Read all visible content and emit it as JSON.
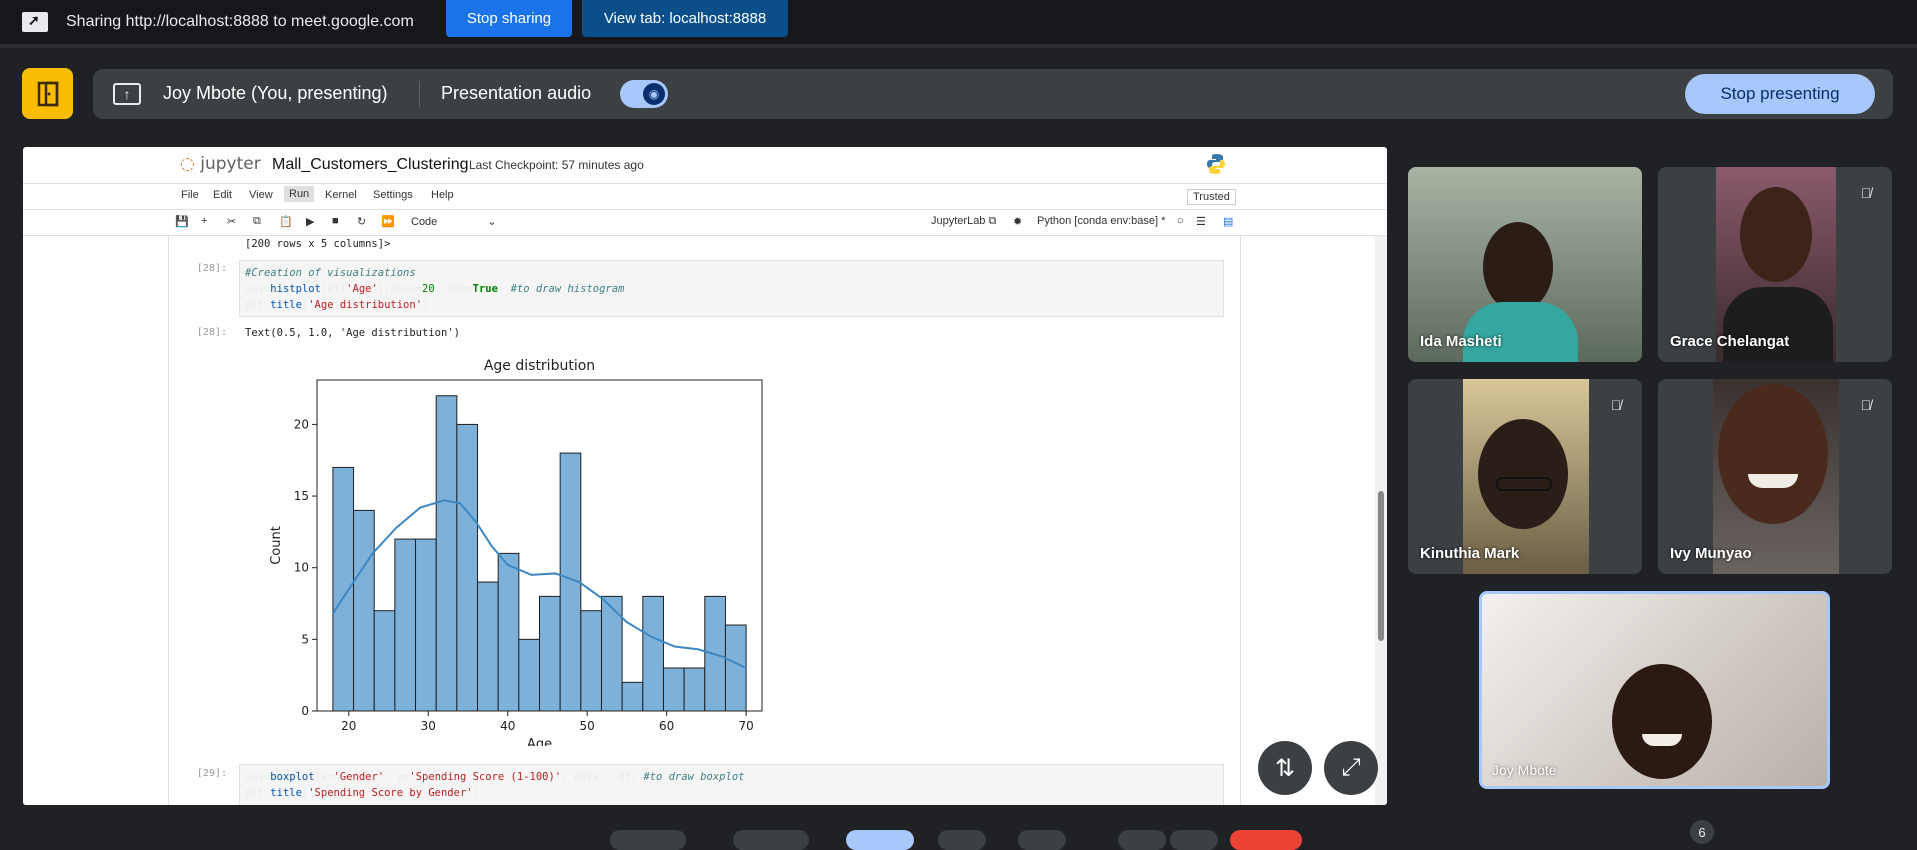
{
  "sharing_bar": {
    "text": "Sharing http://localhost:8888 to meet.google.com",
    "stop_sharing": "Stop sharing",
    "view_tab": "View tab: localhost:8888"
  },
  "presenting_bar": {
    "presenter": "Joy Mbote (You, presenting)",
    "audio_label": "Presentation audio",
    "audio_on": true,
    "stop_presenting": "Stop presenting"
  },
  "jupyter": {
    "logo": "jupyter",
    "notebook_title": "Mall_Customers_Clustering",
    "checkpoint": "Last Checkpoint: 57 minutes ago",
    "menu": [
      "File",
      "Edit",
      "View",
      "Run",
      "Kernel",
      "Settings",
      "Help"
    ],
    "trusted": "Trusted",
    "cell_type": "Code",
    "jupyterlab_link": "JupyterLab",
    "kernel": "Python [conda env:base] *",
    "output_prev": "[200 rows x 5 columns]>",
    "cell28_prompt": "[28]:",
    "cell28_line1": "#Creation of visualizations",
    "cell28_line2_a": "sns.",
    "cell28_line2_fn": "histplot",
    "cell28_line2_b": "(df[",
    "cell28_line2_str": "'Age'",
    "cell28_line2_c": "],bins=",
    "cell28_line2_num": "20",
    "cell28_line2_d": ", kde=",
    "cell28_line2_kw": "True",
    "cell28_line2_e": ") ",
    "cell28_line2_cmt": "#to draw histogram",
    "cell28_line3_a": "plt.",
    "cell28_line3_fn": "title",
    "cell28_line3_b": "(",
    "cell28_line3_str": "'Age distribution'",
    "cell28_line3_c": ")",
    "out28_prompt": "[28]:",
    "out28_text": "Text(0.5, 1.0, 'Age distribution')",
    "cell29_prompt": "[29]:",
    "cell29_line1_a": "sns.",
    "cell29_line1_fn": "boxplot",
    "cell29_line1_b": "(x=",
    "cell29_line1_str1": "'Gender'",
    "cell29_line1_c": ", y=",
    "cell29_line1_str2": "'Spending  Score (1-100)'",
    "cell29_line1_d": ", data = df) ",
    "cell29_line1_cmt": "#to draw  boxplot",
    "cell29_line2_a": "plt.",
    "cell29_line2_fn": "title",
    "cell29_line2_b": "(",
    "cell29_line2_str": "'Spending Score by Gender'",
    "cell29_line2_c": ")"
  },
  "chart_data": {
    "type": "bar",
    "title": "Age distribution",
    "xlabel": "Age",
    "ylabel": "Count",
    "bin_edges": [
      18,
      20.6,
      23.2,
      25.8,
      28.4,
      31,
      33.6,
      36.2,
      38.8,
      41.4,
      44,
      46.6,
      49.2,
      51.8,
      54.4,
      57,
      59.6,
      62.2,
      64.8,
      67.4,
      70
    ],
    "values": [
      17,
      14,
      7,
      12,
      12,
      22,
      20,
      9,
      11,
      5,
      8,
      18,
      7,
      8,
      2,
      8,
      3,
      3,
      8,
      6
    ],
    "kde_series": {
      "name": "kde",
      "x": [
        18,
        20,
        23,
        26,
        29,
        32,
        34,
        36,
        38,
        40,
        43,
        46,
        49,
        52,
        55,
        58,
        61,
        64,
        67,
        70
      ],
      "y": [
        6.8,
        8.5,
        11.0,
        12.8,
        14.2,
        14.7,
        14.5,
        13.2,
        11.5,
        10.2,
        9.5,
        9.6,
        9.0,
        7.8,
        6.2,
        5.2,
        4.5,
        4.3,
        3.8,
        3.0
      ]
    },
    "xticks": [
      20,
      30,
      40,
      50,
      60,
      70
    ],
    "yticks": [
      0,
      5,
      10,
      15,
      20
    ],
    "xlim": [
      16,
      72
    ],
    "ylim": [
      0,
      23.1
    ],
    "bar_color": "#7eb1d9",
    "kde_color": "#3d87c2",
    "grid": false
  },
  "participants": [
    {
      "name": "Ida Masheti",
      "muted": false
    },
    {
      "name": "Grace Chelangat",
      "muted": true
    },
    {
      "name": "Kinuthia Mark",
      "muted": true
    },
    {
      "name": "Ivy Munyao",
      "muted": true
    }
  ],
  "self_view": {
    "name": "Joy Mbote"
  },
  "participant_count": "6",
  "colors": {
    "accent": "#1a73e8",
    "highlight": "#a8c7fa",
    "exit": "#fbbc04"
  }
}
